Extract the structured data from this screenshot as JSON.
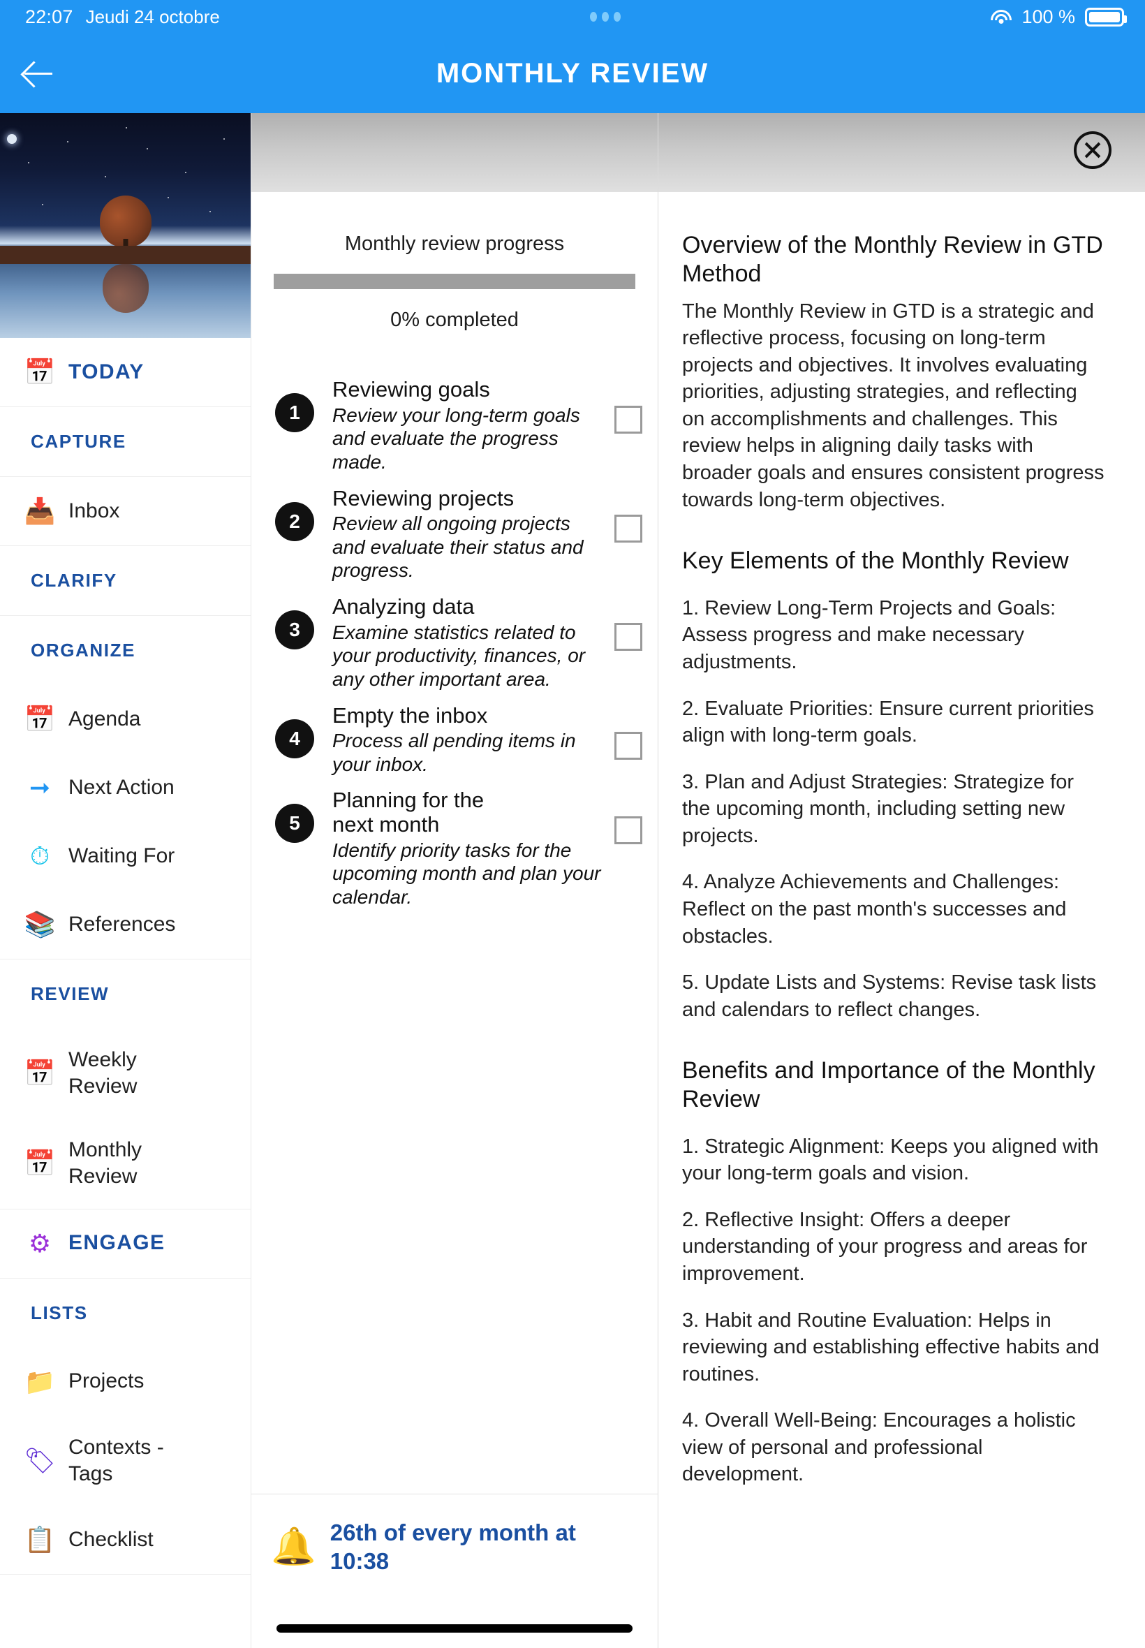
{
  "statusbar": {
    "time": "22:07",
    "date": "Jeudi 24 octobre",
    "battery_percent": "100 %",
    "wifi_icon": "wifi-icon",
    "battery_icon": "battery-full-icon",
    "dots_icon": "three-dots-icon"
  },
  "appbar": {
    "title": "MONTHLY REVIEW",
    "back_icon": "back-arrow-icon"
  },
  "sidebar": {
    "today": {
      "label": "TODAY",
      "icon": "calendar-check-icon"
    },
    "sections": [
      {
        "header": "CAPTURE",
        "items": [
          {
            "label": "Inbox",
            "icon": "inbox-tray-icon"
          }
        ]
      },
      {
        "header": "CLARIFY",
        "items": []
      },
      {
        "header": "ORGANIZE",
        "items": [
          {
            "label": "Agenda",
            "icon": "calendar-icon"
          },
          {
            "label": "Next Action",
            "icon": "right-arrow-icon"
          },
          {
            "label": "Waiting For",
            "icon": "person-waiting-clock-icon"
          },
          {
            "label": "References",
            "icon": "books-binder-icon"
          }
        ]
      },
      {
        "header": "REVIEW",
        "items": [
          {
            "label": "Weekly Review",
            "icon": "calendar-week-icon"
          },
          {
            "label": "Monthly Review",
            "icon": "calendar-month-icon"
          }
        ]
      },
      {
        "header": "",
        "items": [
          {
            "label": "ENGAGE",
            "icon": "gears-icon",
            "emphasis": true
          }
        ]
      },
      {
        "header": "LISTS",
        "items": [
          {
            "label": "Projects",
            "icon": "open-folder-icon"
          },
          {
            "label": "Contexts - Tags",
            "icon": "tags-icon"
          },
          {
            "label": "Checklist",
            "icon": "checklist-pencil-icon"
          }
        ]
      }
    ]
  },
  "progress": {
    "title": "Monthly review progress",
    "percent_label": "0% completed",
    "percent_value": 0,
    "bar_color": "#9e9e9e"
  },
  "steps": [
    {
      "number": "1",
      "title": "Reviewing goals",
      "description": "Review your long-term goals and evaluate the progress made.",
      "checked": false
    },
    {
      "number": "2",
      "title": "Reviewing projects",
      "description": "Review all ongoing projects and evaluate their status and progress.",
      "checked": false
    },
    {
      "number": "3",
      "title": "Analyzing data",
      "description": "Examine statistics related to your productivity, finances, or any other important area.",
      "checked": false
    },
    {
      "number": "4",
      "title": "Empty the inbox",
      "description": "Process all pending items in your inbox.",
      "checked": false
    },
    {
      "number": "5",
      "title": "Planning for the next month",
      "description": "Identify priority tasks for the upcoming month and plan your calendar.",
      "checked": false
    }
  ],
  "reminder": {
    "icon": "bell-icon",
    "text": "26th of every month at 10:38"
  },
  "detail": {
    "close_icon": "close-circle-icon",
    "heading1": "Overview of the Monthly Review in GTD Method",
    "intro": "The Monthly Review in GTD is a strategic and reflective process, focusing on long-term projects and objectives. It involves evaluating priorities, adjusting strategies, and reflecting on accomplishments and challenges. This review helps in aligning daily tasks with broader goals and ensures consistent progress towards long-term objectives.",
    "heading2": "Key Elements of the Monthly Review",
    "key_elements": [
      "1. Review Long-Term Projects and Goals: Assess progress and make necessary adjustments.",
      "2. Evaluate Priorities: Ensure current priorities align with long-term goals.",
      "3. Plan and Adjust Strategies: Strategize for the upcoming month, including setting new projects.",
      "4. Analyze Achievements and Challenges: Reflect on the past month's successes and obstacles.",
      "5. Update Lists and Systems: Revise task lists and calendars to reflect changes."
    ],
    "heading3": "Benefits and Importance of the Monthly Review",
    "benefits": [
      "1. Strategic Alignment: Keeps you aligned with your long-term goals and vision.",
      "2. Reflective Insight: Offers a deeper understanding of your progress and areas for improvement.",
      "3. Habit and Routine Evaluation: Helps in reviewing and establishing effective habits and routines.",
      "4. Overall Well-Being: Encourages a holistic view of personal and professional development."
    ]
  },
  "colors": {
    "accent_blue": "#2196f3",
    "link_blue": "#1a4fa0",
    "progress_gray": "#9e9e9e"
  }
}
